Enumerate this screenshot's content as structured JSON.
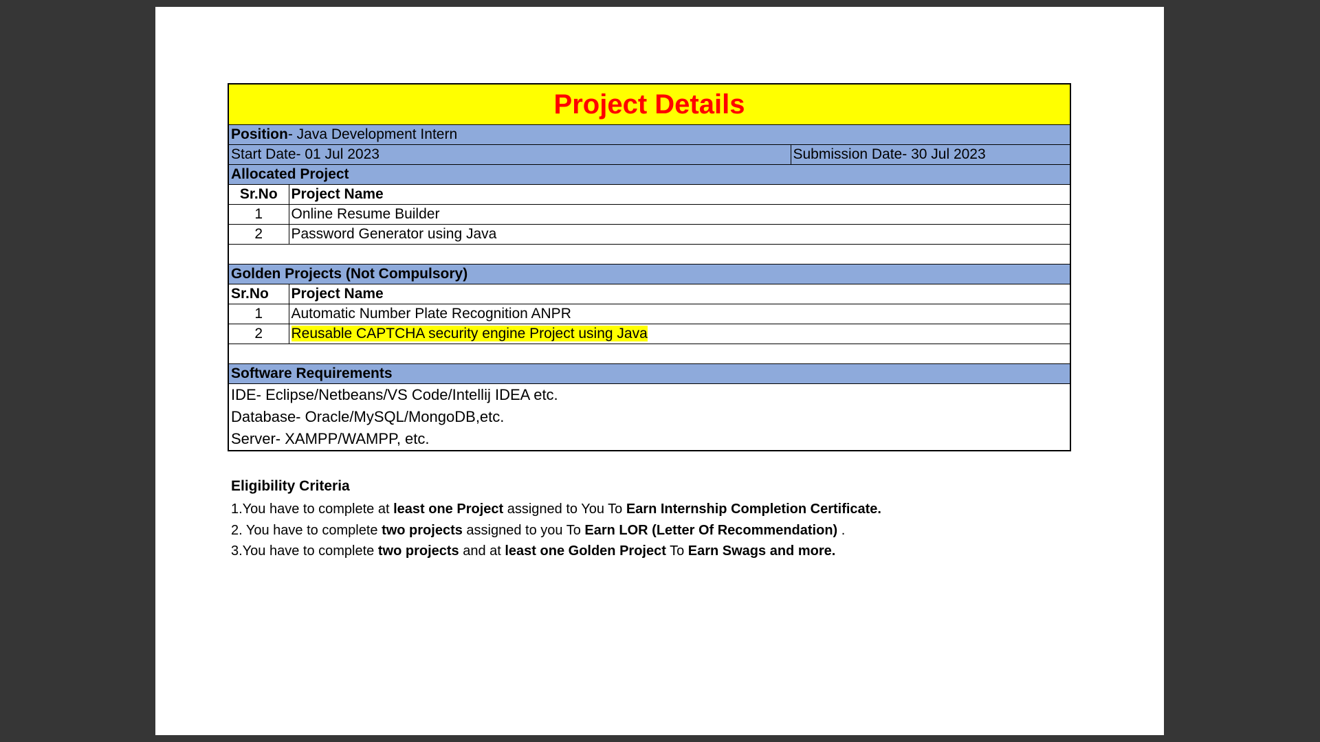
{
  "document": {
    "title": "Project Details",
    "position_label": "Position",
    "position_value": "- Java Development Intern",
    "start_date": "Start Date- 01 Jul 2023",
    "submission_date": "Submission Date- 30 Jul 2023",
    "allocated": {
      "heading": "Allocated Project",
      "col_srno": "Sr.No",
      "col_name": "Project Name",
      "rows": [
        {
          "srno": "1",
          "name": "Online Resume Builder"
        },
        {
          "srno": "2",
          "name": "Password Generator using Java"
        }
      ]
    },
    "golden": {
      "heading": "Golden Projects (Not Compulsory)",
      "col_srno": "Sr.No",
      "col_name": "Project Name",
      "rows": [
        {
          "srno": "1",
          "name": "Automatic Number Plate Recognition ANPR"
        },
        {
          "srno": "2",
          "name": "Reusable CAPTCHA security engine Project using Java"
        }
      ]
    },
    "software": {
      "heading": "Software Requirements",
      "items": [
        "IDE- Eclipse/Netbeans/VS Code/Intellij IDEA etc.",
        "Database- Oracle/MySQL/MongoDB,etc.",
        "Server- XAMPP/WAMPP, etc."
      ]
    },
    "eligibility": {
      "heading": "Eligibility Criteria",
      "c1": [
        "1.You have to complete at ",
        "least one Project",
        " assigned to You To ",
        "Earn Internship Completion Certificate."
      ],
      "c2": [
        "2. You have to complete ",
        "two projects",
        " assigned to you To ",
        "Earn LOR (Letter Of Recommendation)",
        " ."
      ],
      "c3": [
        "3.You have to complete ",
        "two projects",
        " and at ",
        "least one Golden Project",
        " To ",
        "Earn Swags and more."
      ]
    }
  },
  "colors": {
    "title_bg": "#ffff00",
    "title_text": "#ff0000",
    "section_bg": "#8eaadb",
    "viewer_bg": "#363636"
  }
}
